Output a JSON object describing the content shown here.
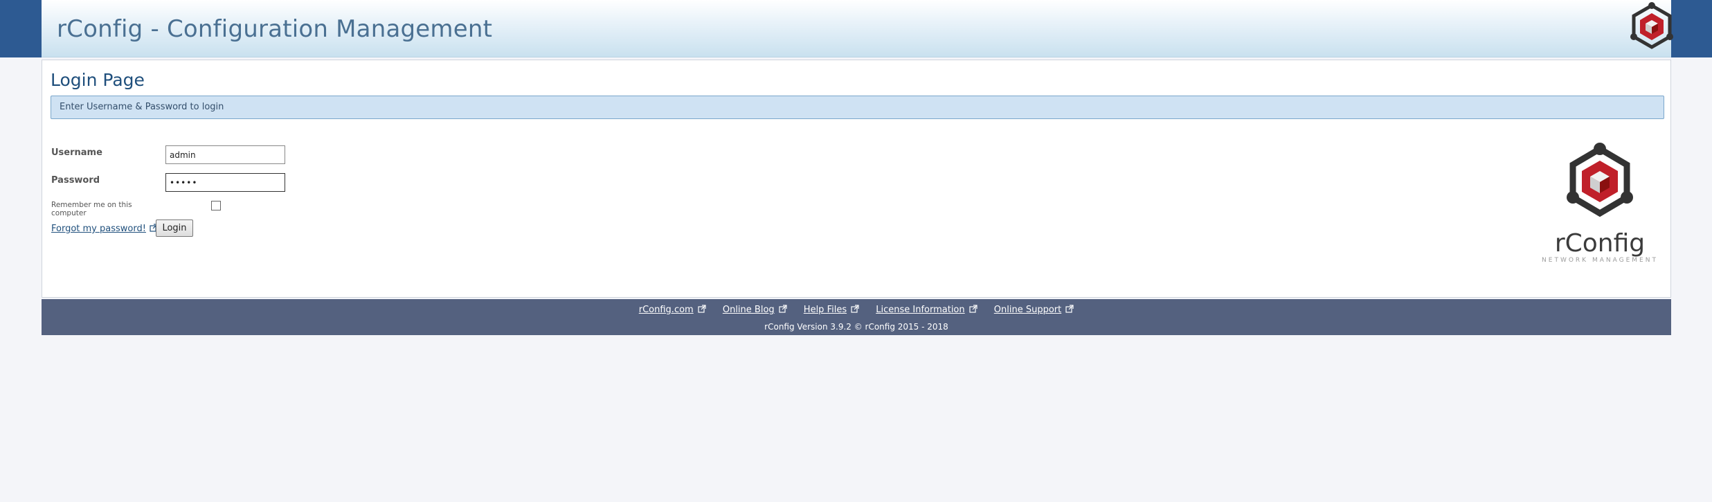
{
  "header": {
    "title": "rConfig - Configuration Management",
    "logo_icon": "rconfig-logo-icon"
  },
  "login": {
    "page_title": "Login Page",
    "info_message": "Enter Username & Password to login",
    "username_label": "Username",
    "username_value": "admin",
    "password_label": "Password",
    "password_value": "•••••",
    "remember_label": "Remember me on this computer",
    "remember_checked": false,
    "forgot_label": "Forgot my password!",
    "login_button": "Login"
  },
  "brand": {
    "name": "rConfig",
    "tagline": "NETWORK MANAGEMENT"
  },
  "footer": {
    "links": [
      "rConfig.com",
      "Online Blog",
      "Help Files",
      "License Information",
      "Online Support"
    ],
    "version": "rConfig Version 3.9.2   © rConfig 2015 - 2018"
  },
  "colors": {
    "accent": "#2d5a92",
    "footer_bg": "#54617f",
    "info_bg": "#cfe2f3",
    "logo_red": "#c0202a"
  }
}
